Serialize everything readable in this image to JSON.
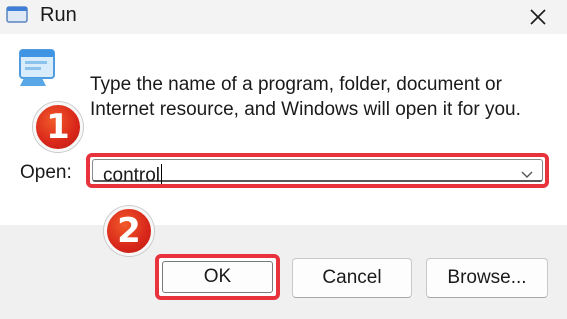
{
  "window": {
    "title": "Run",
    "title_icon": "run-dialog-icon",
    "close_icon": "close-icon"
  },
  "content": {
    "icon": "run-program-icon",
    "description_line1": "Type the name of a program, folder, document or",
    "description_line2": "Internet resource, and Windows will open it for you.",
    "open_label": "Open:",
    "open_value": "control",
    "dropdown_icon": "chevron-down-icon"
  },
  "annotations": {
    "step1": "1",
    "step2": "2",
    "color": "#e8333d"
  },
  "buttons": {
    "ok": "OK",
    "cancel": "Cancel",
    "browse": "Browse..."
  }
}
